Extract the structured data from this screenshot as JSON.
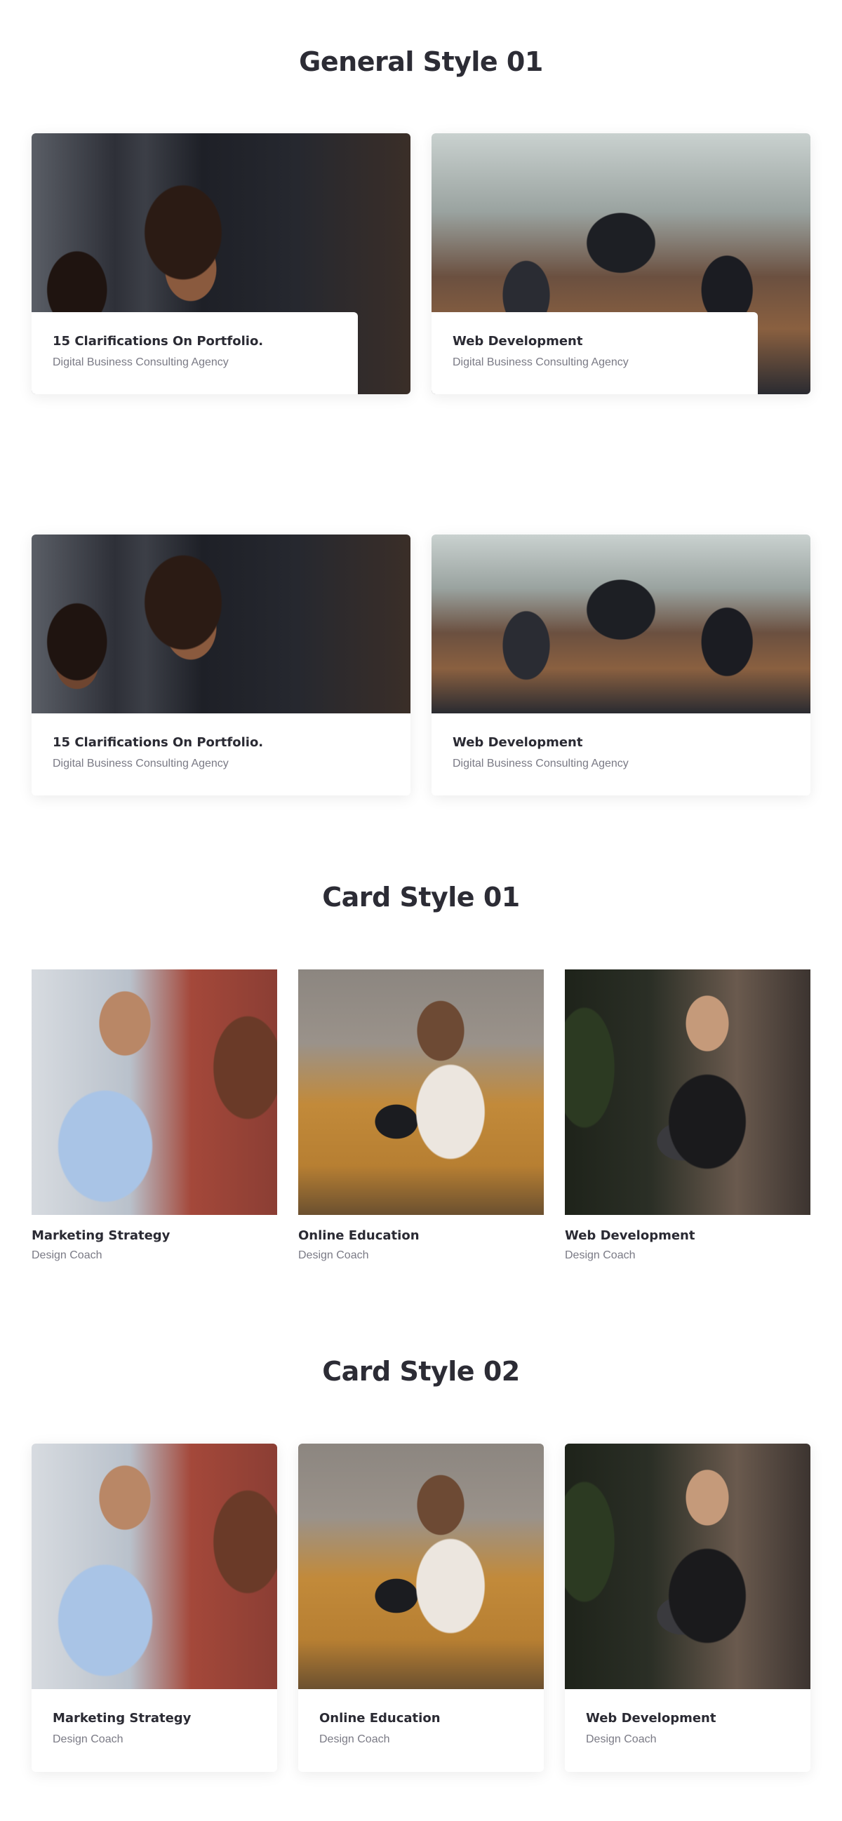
{
  "sections": {
    "general_title": "General Style 01",
    "card1_title": "Card Style 01",
    "card2_title": "Card Style 02"
  },
  "general_row1": [
    {
      "title": "15 Clarifications On Portfolio.",
      "subtitle": "Digital Business Consulting Agency",
      "image": "two-women-smiling-photo"
    },
    {
      "title": "Web Development",
      "subtitle": "Digital Business Consulting Agency",
      "image": "men-working-at-laptop-photo"
    }
  ],
  "general_row2": [
    {
      "title": "15 Clarifications On Portfolio.",
      "subtitle": "Digital Business Consulting Agency",
      "image": "two-women-smiling-photo"
    },
    {
      "title": "Web Development",
      "subtitle": "Digital Business Consulting Agency",
      "image": "men-working-at-laptop-photo"
    }
  ],
  "card_style_01": [
    {
      "title": "Marketing Strategy",
      "subtitle": "Design Coach",
      "image": "man-with-tablet-photo"
    },
    {
      "title": "Online Education",
      "subtitle": "Design Coach",
      "image": "woman-on-sofa-photo"
    },
    {
      "title": "Web Development",
      "subtitle": "Design Coach",
      "image": "woman-with-laptop-photo"
    }
  ],
  "card_style_02": [
    {
      "title": "Marketing Strategy",
      "subtitle": "Design Coach",
      "image": "man-with-tablet-photo"
    },
    {
      "title": "Online Education",
      "subtitle": "Design Coach",
      "image": "woman-on-sofa-photo"
    },
    {
      "title": "Web Development",
      "subtitle": "Design Coach",
      "image": "woman-with-laptop-photo"
    }
  ],
  "colors": {
    "heading": "#2c2c35",
    "title": "#2a2a33",
    "subtitle": "#7a7a85",
    "background": "#ffffff"
  }
}
